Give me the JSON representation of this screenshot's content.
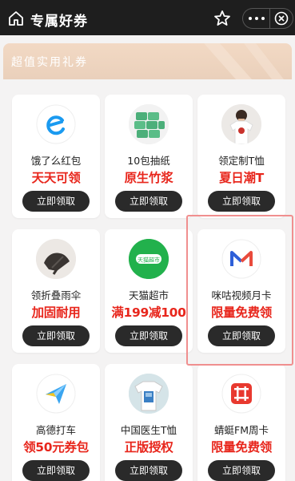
{
  "header": {
    "title": "专属好券"
  },
  "section": {
    "title": "超值实用礼券"
  },
  "colors": {
    "promo": "#e8261c",
    "button_bg": "#2a2a2a",
    "highlight": "#f08f8f"
  },
  "button_label": "立即领取",
  "coupons": [
    {
      "name": "饿了么红包",
      "promo": "天天可领",
      "icon": "eleme-icon"
    },
    {
      "name": "10包抽纸",
      "promo": "原生竹浆",
      "icon": "tissue-icon"
    },
    {
      "name": "领定制T恤",
      "promo": "夏日潮T",
      "icon": "tshirt-photo-icon"
    },
    {
      "name": "领折叠雨伞",
      "promo": "加固耐用",
      "icon": "umbrella-icon"
    },
    {
      "name": "天猫超市",
      "promo": "满199减100",
      "icon": "tmall-supermarket-icon",
      "badge": "天猫超市"
    },
    {
      "name": "咪咕视频月卡",
      "promo": "限量免费领",
      "icon": "migu-video-icon"
    },
    {
      "name": "高德打车",
      "promo": "领50元券包",
      "icon": "amap-taxi-icon"
    },
    {
      "name": "中国医生T恤",
      "promo": "正版授权",
      "icon": "doctor-tshirt-icon"
    },
    {
      "name": "蜻蜓FM周卡",
      "promo": "限量免费领",
      "icon": "qingting-fm-icon"
    }
  ]
}
